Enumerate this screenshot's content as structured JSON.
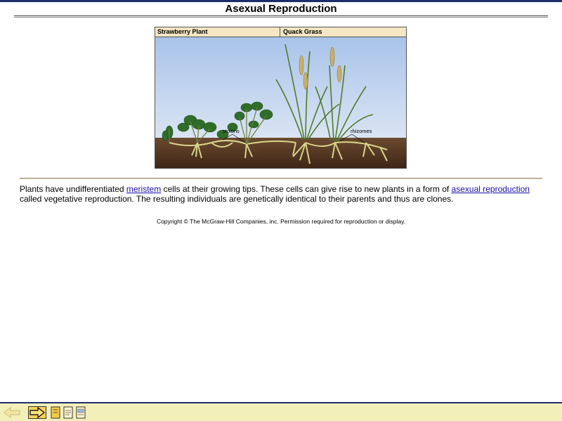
{
  "page": {
    "title": "Asexual Reproduction"
  },
  "figure": {
    "left_header": "Strawberry Plant",
    "right_header": "Quack Grass",
    "label_stolons": "stolons",
    "label_rhizomes": "rhizomes"
  },
  "caption": {
    "part1": "Plants have undifferentiated ",
    "link1": "meristem",
    "part2": " cells at their growing tips. These cells can give rise to new plants in a form of ",
    "link2": "asexual reproduction",
    "part3": " called vegetative reproduction. The resulting individuals are genetically identical to their parents and thus are clones."
  },
  "copyright": "Copyright © The McGraw-Hill Companies, inc. Permission required for reproduction or display.",
  "toolbar": {
    "icons": [
      "back-arrow-icon",
      "forward-arrow-icon",
      "notes-icon",
      "page-icon",
      "document-icon"
    ]
  }
}
